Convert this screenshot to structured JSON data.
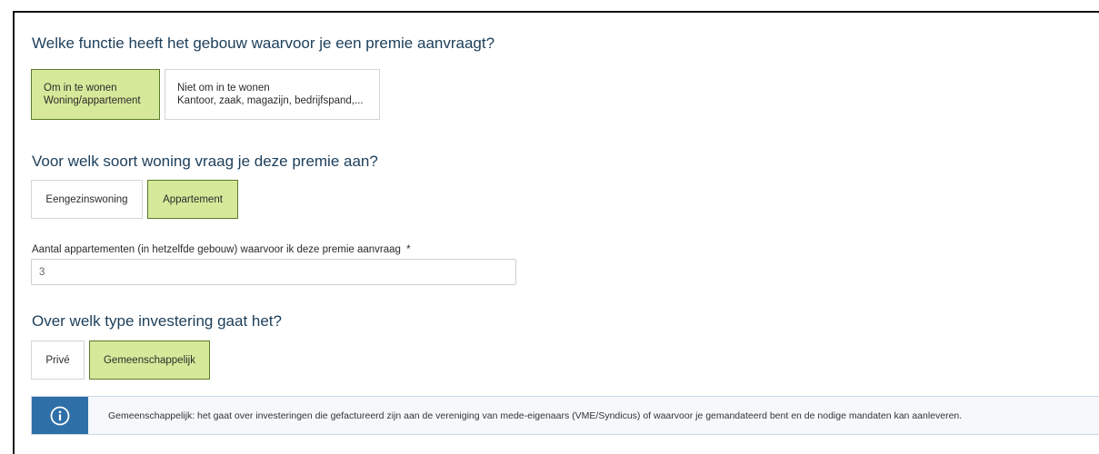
{
  "section1": {
    "heading": "Welke functie heeft het gebouw waarvoor je een premie aanvraagt?",
    "options": [
      {
        "line1": "Om in te wonen",
        "line2": "Woning/appartement",
        "selected": true
      },
      {
        "line1": "Niet om in te wonen",
        "line2": "Kantoor, zaak, magazijn, bedrijfspand,...",
        "selected": false
      }
    ]
  },
  "section2": {
    "heading": "Voor welk soort woning vraag je deze premie aan?",
    "options": [
      {
        "label": "Eengezinswoning",
        "selected": false
      },
      {
        "label": "Appartement",
        "selected": true
      }
    ]
  },
  "apartments": {
    "label": "Aantal appartementen (in hetzelfde gebouw) waarvoor ik deze premie aanvraag",
    "required_marker": "*",
    "value": "3"
  },
  "section3": {
    "heading": "Over welk type investering gaat het?",
    "options": [
      {
        "label": "Privé",
        "selected": false
      },
      {
        "label": "Gemeenschappelijk",
        "selected": true
      }
    ]
  },
  "info": {
    "icon": "info-icon",
    "text": "Gemeenschappelijk: het gaat over investeringen die gefactureerd zijn aan de vereniging van mede-eigenaars (VME/Syndicus) of waarvoor je gemandateerd bent en de nodige mandaten kan aanleveren."
  },
  "colors": {
    "selected_bg": "#d6e99a",
    "selected_border": "#5a7a2a",
    "heading": "#1c3e5a",
    "info_accent": "#2f6fa8"
  }
}
